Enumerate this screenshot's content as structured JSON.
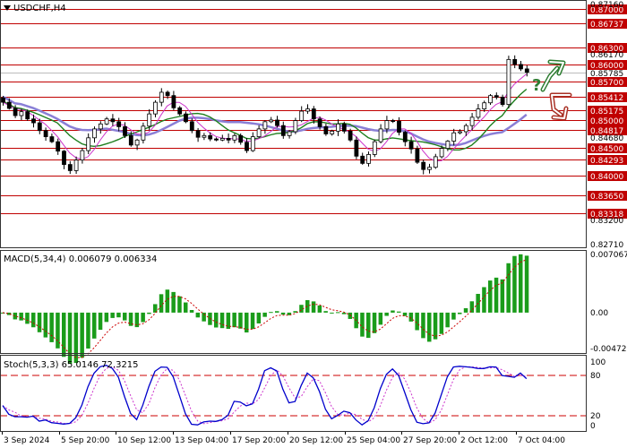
{
  "symbol_title": "USDCHF,H4",
  "menu_icon": "triangle-down-icon",
  "signal": {
    "question": "?",
    "up_icon": "arrow-up-icon",
    "down_icon": "arrow-down-icon",
    "up_color": "#2e7d32",
    "down_color": "#a93226"
  },
  "colors": {
    "level_line": "#c00000",
    "level_badge": "#c00000",
    "candle": "#000000",
    "ma_fast": "#cc33cc",
    "ma_mid": "#1e7f1e",
    "ma_slow": "#8a7fd6",
    "macd_hist": "#1a9c1a",
    "signal_line": "#cc0000",
    "stoch_main": "#0000cc",
    "stoch_signal": "#cc33cc"
  },
  "chart_data": [
    {
      "type": "candlestick",
      "title": "USDCHF,H4",
      "ylim": [
        0.8271,
        0.8716
      ],
      "axis_ticks": [
        "0.87160",
        "0.86170",
        "0.84680",
        "0.83200",
        "0.82710"
      ],
      "level_labels": [
        "0.87000",
        "0.86737",
        "0.86300",
        "0.86000",
        "0.85700",
        "0.85412",
        "0.85175",
        "0.85000",
        "0.84817",
        "0.84500",
        "0.84293",
        "0.84000",
        "0.83650",
        "0.83318"
      ],
      "levels": [
        0.87,
        0.86737,
        0.863,
        0.86,
        0.857,
        0.85412,
        0.85175,
        0.85,
        0.84817,
        0.845,
        0.84293,
        0.84,
        0.8365,
        0.83318
      ],
      "current_price_label": "0.85785",
      "x_labels": [
        "3 Sep 2024",
        "5 Sep 20:00",
        "10 Sep 12:00",
        "13 Sep 04:00",
        "17 Sep 20:00",
        "20 Sep 12:00",
        "25 Sep 04:00",
        "27 Sep 20:00",
        "2 Oct 12:00",
        "7 Oct 04:00"
      ],
      "closes": [
        0.8532,
        0.8521,
        0.8508,
        0.8515,
        0.8502,
        0.8495,
        0.8481,
        0.847,
        0.8461,
        0.8444,
        0.842,
        0.8409,
        0.8428,
        0.8445,
        0.8468,
        0.8484,
        0.8493,
        0.8502,
        0.8497,
        0.8488,
        0.8472,
        0.8455,
        0.8464,
        0.8489,
        0.8511,
        0.8532,
        0.855,
        0.8544,
        0.8522,
        0.8511,
        0.8497,
        0.8481,
        0.8469,
        0.8472,
        0.8466,
        0.8464,
        0.8467,
        0.8464,
        0.8472,
        0.846,
        0.8445,
        0.847,
        0.8484,
        0.8497,
        0.85,
        0.849,
        0.8472,
        0.8479,
        0.8499,
        0.8516,
        0.852,
        0.8502,
        0.8488,
        0.8475,
        0.848,
        0.8493,
        0.848,
        0.8464,
        0.8435,
        0.8422,
        0.8438,
        0.8461,
        0.8484,
        0.8499,
        0.8498,
        0.8478,
        0.8461,
        0.8448,
        0.8424,
        0.8411,
        0.8415,
        0.8434,
        0.8449,
        0.8462,
        0.8477,
        0.8479,
        0.849,
        0.8505,
        0.852,
        0.8531,
        0.8544,
        0.8541,
        0.8528,
        0.8609,
        0.86,
        0.8592,
        0.8586
      ],
      "macd": {
        "label": "MACD(5,34,4) 0.006079 0.006334",
        "ylim": [
          -0.004729,
          0.007067
        ],
        "axis_ticks": [
          "0.007067",
          "0.00",
          "-0.004729"
        ]
      },
      "stoch": {
        "label": "Stoch(5,3,3) 65.0146 72.3215",
        "ylim": [
          0,
          100
        ],
        "levels": [
          20,
          80
        ],
        "axis_ticks": [
          "100",
          "80",
          "20",
          "0"
        ]
      }
    }
  ]
}
